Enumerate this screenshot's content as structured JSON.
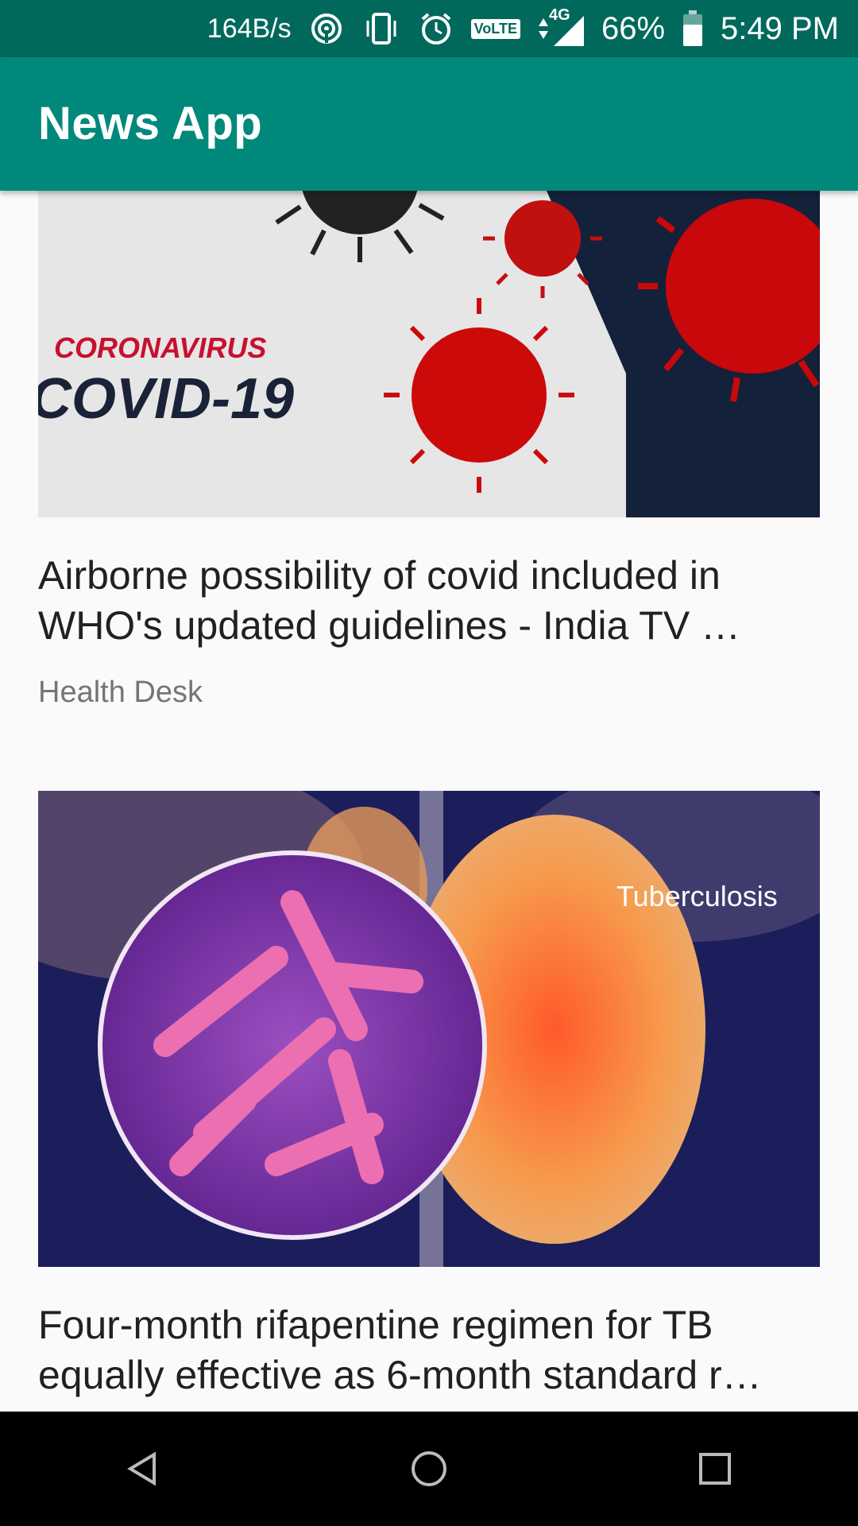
{
  "status_bar": {
    "net_speed": "164B/s",
    "volte": "VoLTE",
    "network": "4G",
    "battery": "66%",
    "time": "5:49 PM",
    "icons": [
      "hotspot-icon",
      "vibrate-icon",
      "alarm-icon",
      "volte-icon",
      "signal-icon",
      "battery-icon"
    ]
  },
  "app_bar": {
    "title": "News App"
  },
  "articles": [
    {
      "image_text_1": "CORONAVIRUS",
      "image_text_2": "COVID-19",
      "headline": "Airborne possibility of covid included in WHO's updated guidelines - India TV …",
      "source": "Health Desk"
    },
    {
      "image_text_1": "Tuberculosis",
      "headline": "Four-month rifapentine regimen for TB equally effective as 6-month standard r…"
    }
  ],
  "nav_bar": {
    "icons": [
      "back-icon",
      "home-icon",
      "recents-icon"
    ]
  },
  "colors": {
    "status_bar": "#00695c",
    "app_bar": "#00897b",
    "background": "#fafafa"
  }
}
